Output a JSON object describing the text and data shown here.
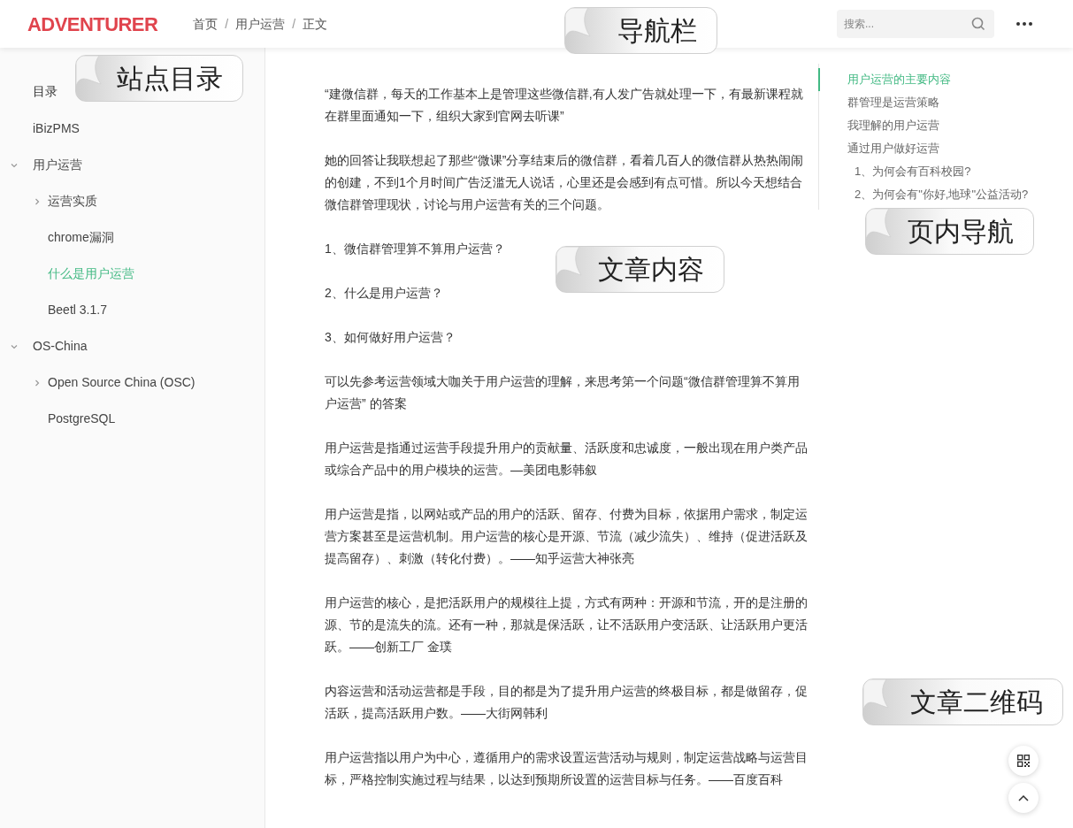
{
  "header": {
    "logo": "ADVENTURER",
    "breadcrumb": [
      "首页",
      "用户运营",
      "正文"
    ],
    "separator": "/",
    "search": {
      "placeholder": "搜索..."
    }
  },
  "sidebar": {
    "title": "目录",
    "items": [
      {
        "label": "iBizPMS",
        "selected": false
      },
      {
        "label": "用户运营",
        "selected": false,
        "expanded": true,
        "children": [
          {
            "label": "运营实质",
            "selected": false,
            "expanded": false
          },
          {
            "label": "chrome漏洞",
            "selected": false
          },
          {
            "label": "什么是用户运营",
            "selected": true
          },
          {
            "label": "Beetl 3.1.7",
            "selected": false
          }
        ]
      },
      {
        "label": "OS-China",
        "selected": false,
        "expanded": true,
        "children": [
          {
            "label": "Open Source China (OSC)",
            "selected": false,
            "expanded": false
          },
          {
            "label": "PostgreSQL",
            "selected": false
          }
        ]
      }
    ]
  },
  "article": {
    "paragraphs": [
      "“建微信群，每天的工作基本上是管理这些微信群,有人发广告就处理一下，有最新课程就在群里面通知一下，组织大家到官网去听课”",
      "她的回答让我联想起了那些“微课”分享结束后的微信群，看着几百人的微信群从热热闹闹的创建，不到1个月时间广告泛滥无人说话，心里还是会感到有点可惜。所以今天想结合微信群管理现状，讨论与用户运营有关的三个问题。",
      "1、微信群管理算不算用户运营？",
      "2、什么是用户运营？",
      "3、如何做好用户运营？",
      "可以先参考运营领域大咖关于用户运营的理解，来思考第一个问题“微信群管理算不算用户运营” 的答案",
      "用户运营是指通过运营手段提升用户的贡献量、活跃度和忠诚度，一般出现在用户类产品或综合产品中的用户模块的运营。—美团电影韩叙",
      "用户运营是指，以网站或产品的用户的活跃、留存、付费为目标，依据用户需求，制定运营方案甚至是运营机制。用户运营的核心是开源、节流（减少流失）、维持（促进活跃及提高留存）、刺激（转化付费）。——知乎运营大神张亮",
      "用户运营的核心，是把活跃用户的规模往上提，方式有两种：开源和节流，开的是注册的源、节的是流失的流。还有一种，那就是保活跃，让不活跃用户变活跃、让活跃用户更活跃。——创新工厂 金璞",
      "内容运营和活动运营都是手段，目的都是为了提升用户运营的终极目标，都是做留存，促活跃，提高活跃用户数。——大街网韩利",
      "用户运营指以用户为中心，遵循用户的需求设置运营活动与规则，制定运营战略与运营目标，严格控制实施过程与结果，以达到预期所设置的运营目标与任务。——百度百科"
    ]
  },
  "toc": {
    "items": [
      {
        "label": "用户运营的主要内容",
        "selected": true
      },
      {
        "label": "群管理是运营策略",
        "selected": false
      },
      {
        "label": "我理解的用户运营",
        "selected": false
      },
      {
        "label": "通过用户做好运营",
        "selected": false,
        "children": [
          {
            "label": "1、为何会有百科校园?",
            "selected": false
          },
          {
            "label": "2、为何会有\"你好,地球\"公益活动?",
            "selected": false
          }
        ]
      }
    ]
  },
  "annotations": [
    {
      "label": "站点目录"
    },
    {
      "label": "导航栏"
    },
    {
      "label": "文章内容"
    },
    {
      "label": "页内导航"
    },
    {
      "label": "文章二维码"
    }
  ]
}
